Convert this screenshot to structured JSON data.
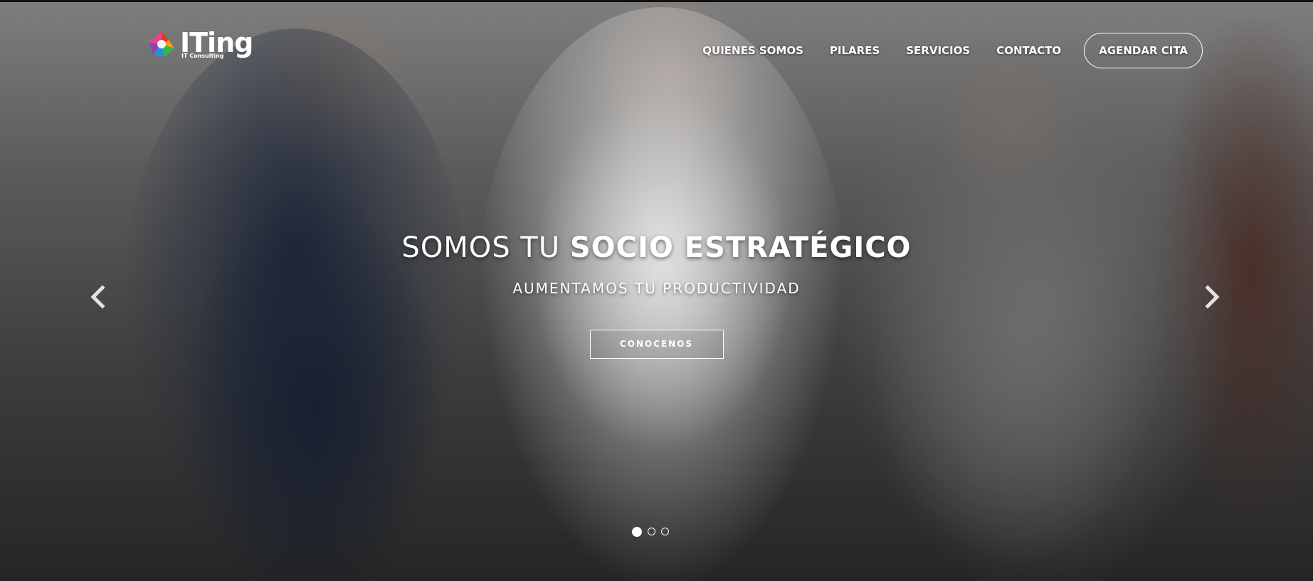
{
  "brand": {
    "name": "ITing",
    "tagline": "IT Consulting",
    "logo_colors": [
      "#e8332a",
      "#f7a21b",
      "#3bb44a",
      "#2b8fd6",
      "#8e44ad"
    ]
  },
  "nav": {
    "items": [
      {
        "label": "QUIENES SOMOS"
      },
      {
        "label": "PILARES"
      },
      {
        "label": "SERVICIOS"
      },
      {
        "label": "CONTACTO"
      }
    ],
    "cta_label": "AGENDAR CITA"
  },
  "hero": {
    "headline_light": "SOMOS TU ",
    "headline_strong": "SOCIO ESTRATÉGICO",
    "subheadline": "AUMENTAMOS TU PRODUCTIVIDAD",
    "button_label": "CONOCENOS"
  },
  "carousel": {
    "prev_icon": "chevron-left-icon",
    "next_icon": "chevron-right-icon",
    "slide_count": 3,
    "active_slide": 1
  }
}
